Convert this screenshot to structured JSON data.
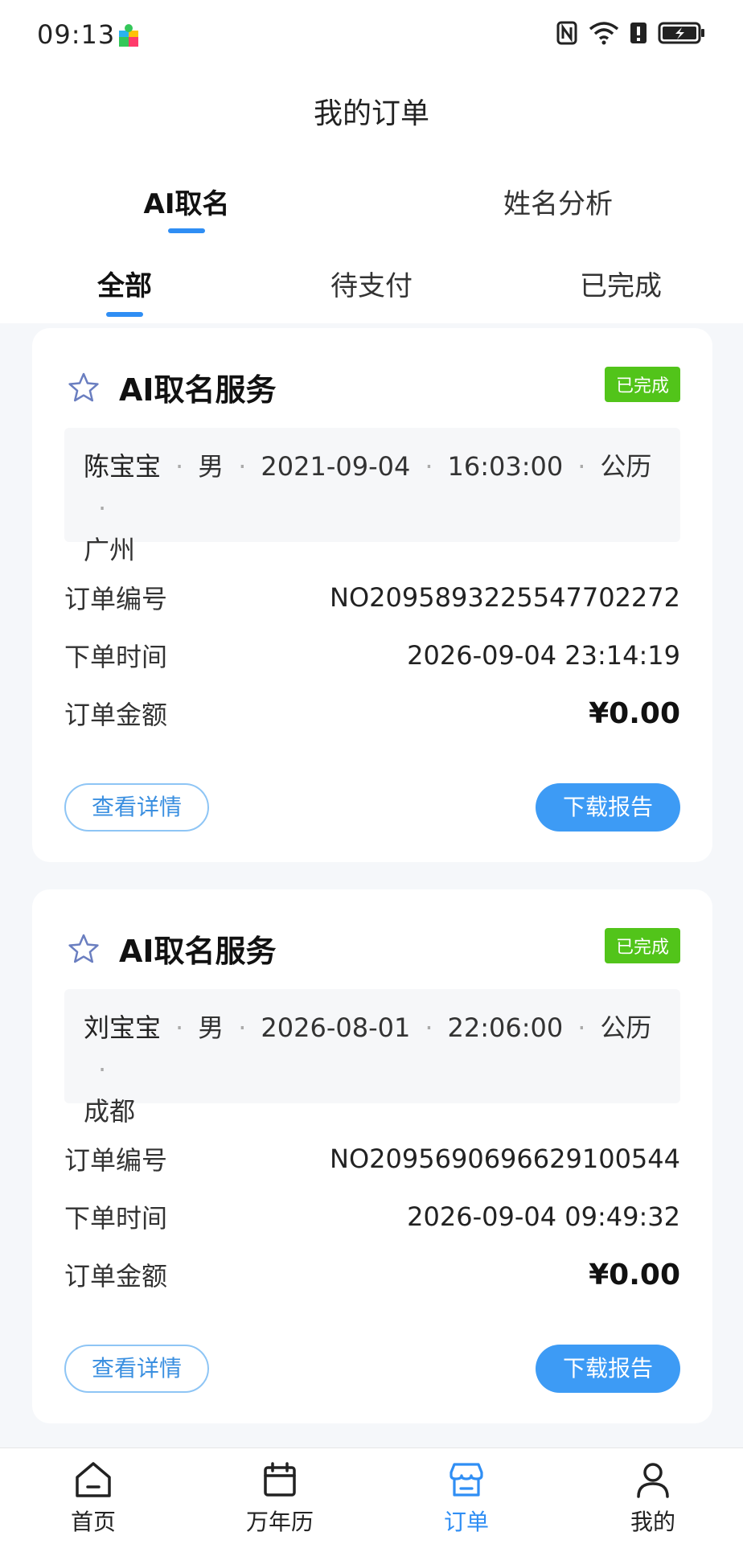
{
  "status_bar": {
    "time": "09:13",
    "icons": [
      "app-puzzle-icon",
      "nfc-icon",
      "wifi-icon",
      "alert-icon",
      "battery-charging-icon"
    ]
  },
  "header": {
    "title": "我的订单"
  },
  "primary_tabs": [
    {
      "label": "AI取名",
      "active": true
    },
    {
      "label": "姓名分析",
      "active": false
    }
  ],
  "secondary_tabs": [
    {
      "label": "全部",
      "active": true
    },
    {
      "label": "待支付",
      "active": false
    },
    {
      "label": "已完成",
      "active": false
    }
  ],
  "orders": [
    {
      "service_title": "AI取名服务",
      "status_badge": "已完成",
      "info": {
        "name": "陈宝宝",
        "gender": "男",
        "date": "2021-09-04",
        "time": "16:03:00",
        "calendar": "公历",
        "city": "广州"
      },
      "order_no_label": "订单编号",
      "order_no": "NO2095893225547702272",
      "order_time_label": "下单时间",
      "order_time": "2026-09-04 23:14:19",
      "amount_label": "订单金额",
      "amount": "¥0.00",
      "detail_button": "查看详情",
      "download_button": "下载报告"
    },
    {
      "service_title": "AI取名服务",
      "status_badge": "已完成",
      "info": {
        "name": "刘宝宝",
        "gender": "男",
        "date": "2026-08-01",
        "time": "22:06:00",
        "calendar": "公历",
        "city": "成都"
      },
      "order_no_label": "订单编号",
      "order_no": "NO2095690696629100544",
      "order_time_label": "下单时间",
      "order_time": "2026-09-04 09:49:32",
      "amount_label": "订单金额",
      "amount": "¥0.00",
      "detail_button": "查看详情",
      "download_button": "下载报告"
    }
  ],
  "bottom_nav": [
    {
      "label": "首页",
      "icon": "home-icon",
      "active": false
    },
    {
      "label": "万年历",
      "icon": "calendar-icon",
      "active": false
    },
    {
      "label": "订单",
      "icon": "orders-store-icon",
      "active": true
    },
    {
      "label": "我的",
      "icon": "profile-icon",
      "active": false
    }
  ],
  "colors": {
    "accent": "#2f8ef4",
    "badge_green": "#52c41a",
    "button_blue": "#3d9bf5"
  }
}
